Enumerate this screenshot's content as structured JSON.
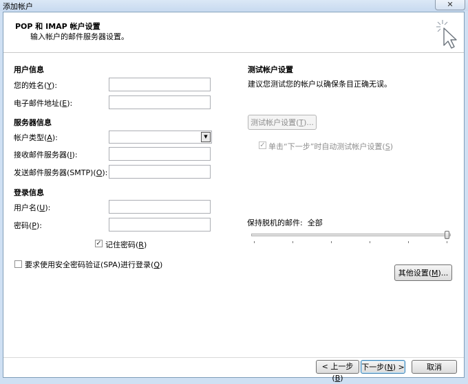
{
  "window": {
    "title": "添加帐户",
    "close_glyph": "✕"
  },
  "header": {
    "title": "POP 和 IMAP 帐户设置",
    "subtitle": "输入帐户的邮件服务器设置。",
    "icon": "wand-cursor-icon"
  },
  "user_info": {
    "heading": "用户信息",
    "name_label": "您的姓名",
    "name_key": "Y",
    "name_value": "",
    "email_label": "电子邮件地址",
    "email_key": "E",
    "email_value": ""
  },
  "server_info": {
    "heading": "服务器信息",
    "type_label": "帐户类型",
    "type_key": "A",
    "type_value": "",
    "incoming_label": "接收邮件服务器",
    "incoming_key": "I",
    "incoming_value": "",
    "outgoing_label": "发送邮件服务器(SMTP)",
    "outgoing_key": "O",
    "outgoing_value": ""
  },
  "login_info": {
    "heading": "登录信息",
    "username_label": "用户名",
    "username_key": "U",
    "username_value": "",
    "password_label": "密码",
    "password_key": "P",
    "password_value": "",
    "remember_label": "记住密码",
    "remember_key": "R",
    "remember_checked": true
  },
  "spa": {
    "label": "要求使用安全密码验证(SPA)进行登录",
    "key": "Q",
    "checked": false
  },
  "test": {
    "heading": "测试帐户设置",
    "description": "建议您测试您的帐户以确保条目正确无误。",
    "button_label": "测试帐户设置",
    "button_key": "T",
    "button_suffix": "...",
    "auto_label": "单击“下一步”时自动测试帐户设置",
    "auto_key": "S",
    "auto_checked": true
  },
  "offline": {
    "label": "保持脱机的邮件:",
    "value": "全部",
    "slider_level": 1.0
  },
  "more_settings": {
    "label": "其他设置",
    "key": "M",
    "suffix": "..."
  },
  "footer": {
    "back_label": "< 上一步",
    "back_key": "B",
    "next_label": "下一步",
    "next_key": "N",
    "next_suffix": " >",
    "cancel_label": "取消"
  },
  "check_glyph": "✓",
  "dropdown_glyph": "▼"
}
